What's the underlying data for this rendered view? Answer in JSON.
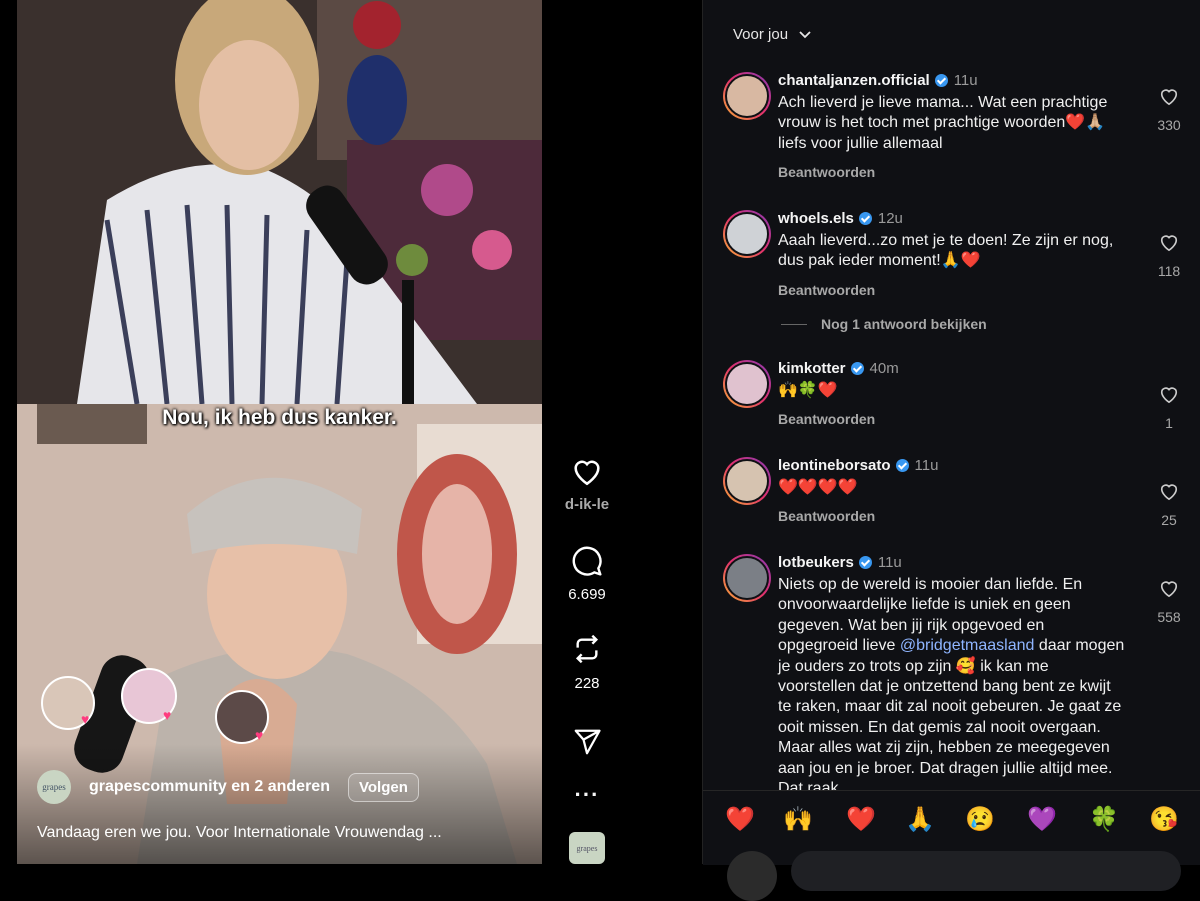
{
  "video": {
    "caption_overlay": "Nou, ik heb dus kanker.",
    "author": "grapescommunity",
    "author_suffix": "en 2 anderen",
    "author_avatar_text": "grapes",
    "follow_label": "Volgen",
    "description": "Vandaag eren we jou. Voor Internationale Vrouwendag ..."
  },
  "actions": {
    "likes_label": "d-ik-le",
    "comments": "6.699",
    "reposts": "228",
    "audio_thumb_text": "grapes"
  },
  "panel": {
    "header": "Voor jou",
    "comments": [
      {
        "user": "chantaljanzen.official",
        "time": "11u",
        "text": "Ach lieverd je lieve mama... Wat een prachtige vrouw is het toch met prachtige woorden❤️🙏🏼 liefs voor jullie allemaal",
        "reply": "Beantwoorden",
        "likes": "330"
      },
      {
        "user": "whoels.els",
        "time": "12u",
        "text": "Aaah lieverd...zo met je te doen! Ze zijn er nog, dus pak ieder moment!🙏❤️",
        "reply": "Beantwoorden",
        "likes": "118"
      },
      {
        "user": "kimkotter",
        "time": "40m",
        "text": "🙌🍀❤️",
        "reply": "Beantwoorden",
        "likes": "1"
      },
      {
        "user": "leontineborsato",
        "time": "11u",
        "text": "❤️❤️❤️❤️",
        "reply": "Beantwoorden",
        "likes": "25"
      },
      {
        "user": "lotbeukers",
        "time": "11u",
        "text_before": "Niets op de wereld is mooier dan liefde. En onvoorwaardelijke liefde is uniek en geen gegeven. Wat ben jij rijk opgevoed en opgegroeid lieve ",
        "mention": "@bridgetmaasland",
        "text_after": " daar mogen je ouders zo trots op zijn 🥰 ik kan me voorstellen dat je ontzettend bang bent ze kwijt te raken, maar dit zal nooit gebeuren. Je gaat ze ooit missen. En dat gemis zal nooit overgaan. Maar alles wat zij zijn, hebben ze meegegeven aan jou en je broer. Dat dragen jullie altijd mee. Dat raak",
        "likes": "558"
      }
    ],
    "more_replies": "Nog 1 antwoord bekijken",
    "emojis": [
      "❤️",
      "🙌",
      "❤️",
      "🙏",
      "😢",
      "💜",
      "🍀",
      "😘"
    ]
  }
}
